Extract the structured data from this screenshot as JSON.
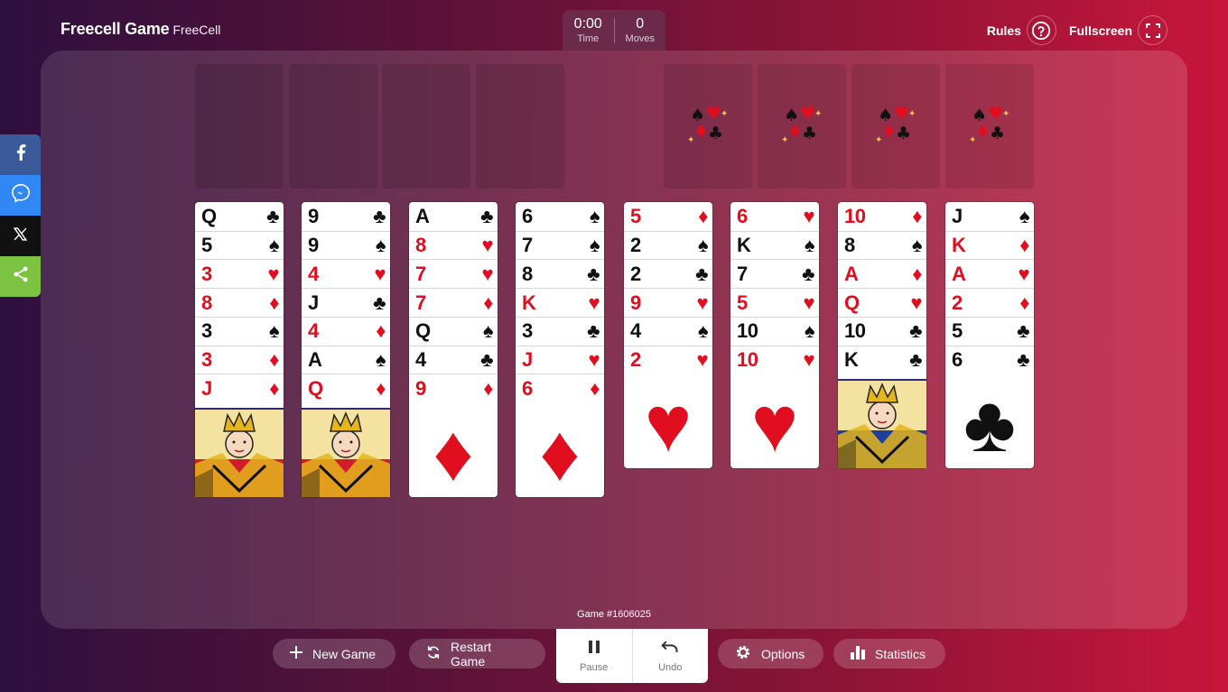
{
  "header": {
    "brand_title": "Freecell Game",
    "brand_sub": "FreeCell",
    "time_value": "0:00",
    "time_label": "Time",
    "moves_value": "0",
    "moves_label": "Moves",
    "rules_label": "Rules",
    "fullscreen_label": "Fullscreen"
  },
  "share": [
    "facebook-icon",
    "messenger-icon",
    "x-icon",
    "share-icon"
  ],
  "free_cells": [
    null,
    null,
    null,
    null
  ],
  "foundations": [
    {
      "icons": "suits-icon"
    },
    {
      "icons": "suits-icon"
    },
    {
      "icons": "suits-icon"
    },
    {
      "icons": "suits-icon"
    }
  ],
  "tableau": [
    [
      {
        "r": "Q",
        "s": "♣"
      },
      {
        "r": "5",
        "s": "♠"
      },
      {
        "r": "3",
        "s": "♥"
      },
      {
        "r": "8",
        "s": "♦"
      },
      {
        "r": "3",
        "s": "♠"
      },
      {
        "r": "3",
        "s": "♦"
      },
      {
        "r": "J",
        "s": "♦"
      }
    ],
    [
      {
        "r": "9",
        "s": "♣"
      },
      {
        "r": "9",
        "s": "♠"
      },
      {
        "r": "4",
        "s": "♥"
      },
      {
        "r": "J",
        "s": "♣"
      },
      {
        "r": "4",
        "s": "♦"
      },
      {
        "r": "A",
        "s": "♠"
      },
      {
        "r": "Q",
        "s": "♦"
      }
    ],
    [
      {
        "r": "A",
        "s": "♣"
      },
      {
        "r": "8",
        "s": "♥"
      },
      {
        "r": "7",
        "s": "♥"
      },
      {
        "r": "7",
        "s": "♦"
      },
      {
        "r": "Q",
        "s": "♠"
      },
      {
        "r": "4",
        "s": "♣"
      },
      {
        "r": "9",
        "s": "♦"
      }
    ],
    [
      {
        "r": "6",
        "s": "♠"
      },
      {
        "r": "7",
        "s": "♠"
      },
      {
        "r": "8",
        "s": "♣"
      },
      {
        "r": "K",
        "s": "♥"
      },
      {
        "r": "3",
        "s": "♣"
      },
      {
        "r": "J",
        "s": "♥"
      },
      {
        "r": "6",
        "s": "♦"
      }
    ],
    [
      {
        "r": "5",
        "s": "♦"
      },
      {
        "r": "2",
        "s": "♠"
      },
      {
        "r": "2",
        "s": "♣"
      },
      {
        "r": "9",
        "s": "♥"
      },
      {
        "r": "4",
        "s": "♠"
      },
      {
        "r": "2",
        "s": "♥"
      }
    ],
    [
      {
        "r": "6",
        "s": "♥"
      },
      {
        "r": "K",
        "s": "♠"
      },
      {
        "r": "7",
        "s": "♣"
      },
      {
        "r": "5",
        "s": "♥"
      },
      {
        "r": "10",
        "s": "♠"
      },
      {
        "r": "10",
        "s": "♥"
      }
    ],
    [
      {
        "r": "10",
        "s": "♦"
      },
      {
        "r": "8",
        "s": "♠"
      },
      {
        "r": "A",
        "s": "♦"
      },
      {
        "r": "Q",
        "s": "♥"
      },
      {
        "r": "10",
        "s": "♣"
      },
      {
        "r": "K",
        "s": "♣"
      }
    ],
    [
      {
        "r": "J",
        "s": "♠"
      },
      {
        "r": "K",
        "s": "♦"
      },
      {
        "r": "A",
        "s": "♥"
      },
      {
        "r": "2",
        "s": "♦"
      },
      {
        "r": "5",
        "s": "♣"
      },
      {
        "r": "6",
        "s": "♣"
      }
    ]
  ],
  "game_number": "Game #1606025",
  "bottom": {
    "new_game": "New Game",
    "restart_game": "Restart Game",
    "pause": "Pause",
    "undo": "Undo",
    "options": "Options",
    "statistics": "Statistics"
  },
  "colors": {
    "red_suit": "#e00e1e",
    "black_suit": "#111111"
  }
}
